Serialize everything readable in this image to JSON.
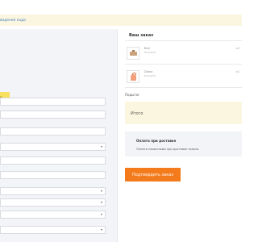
{
  "notice": {
    "text": "ведения кода"
  },
  "form": {
    "yellow_button_label": "ть"
  },
  "order": {
    "title": "Ваш заказ",
    "items": [
      {
        "name": "Bell",
        "price": "Price ₽70",
        "qty": "×1",
        "thumb_icon": "bell-product-image"
      },
      {
        "name": "Diana",
        "price": "Price ₽70",
        "qty": "×1",
        "thumb_icon": "backpack-product-image"
      }
    ],
    "subtotal_label": "Подытог",
    "total_label": "Итого"
  },
  "payment": {
    "title": "Оплата при доставке",
    "description": "Оплата наличными при доставке заказа."
  },
  "actions": {
    "confirm_label": "Подтвердить заказ"
  },
  "colors": {
    "accent": "#f47b1c",
    "highlight": "#fbf6df",
    "panel": "#f3f4f7",
    "yellow_button": "#f6e05e"
  }
}
